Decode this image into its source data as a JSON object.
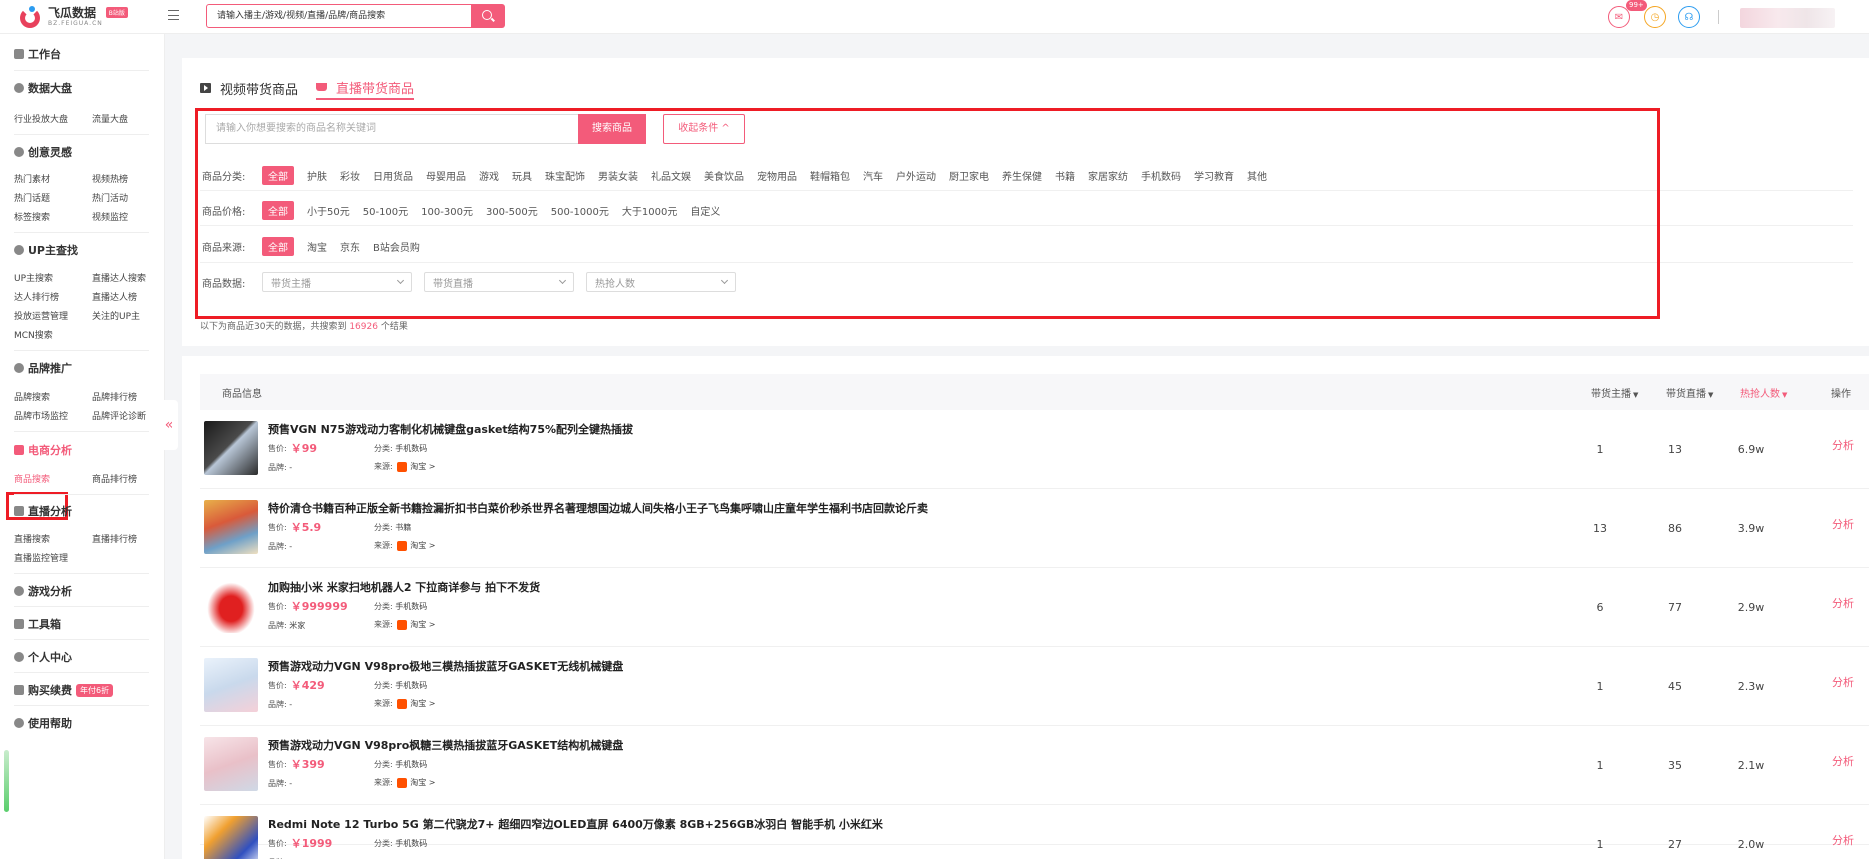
{
  "app": {
    "name": "飞瓜数据",
    "domain": "BZ.FEIGUA.CN",
    "badge": "B站版"
  },
  "colors": {
    "accent": "#f35b7a",
    "annotation": "#ee1c25",
    "taobao": "#ff5000"
  },
  "top": {
    "search_value": "请输入播主/游戏/视频/直播/品牌/商品搜索",
    "msg_count": "99+",
    "icons": [
      "mail-icon",
      "clock-icon",
      "support-icon"
    ]
  },
  "sidebar": {
    "workbench": "工作台",
    "data": {
      "title": "数据大盘",
      "items": [
        "行业投放大盘",
        "流量大盘"
      ]
    },
    "creative": {
      "title": "创意灵感",
      "items": [
        "热门素材",
        "视频热榜",
        "热门话题",
        "热门活动",
        "标签搜索",
        "视频监控"
      ]
    },
    "up": {
      "title": "UP主查找",
      "items": [
        "UP主搜索",
        "直播达人搜索",
        "达人排行榜",
        "直播达人榜",
        "投放运营管理",
        "关注的UP主",
        "MCN搜索"
      ]
    },
    "brand": {
      "title": "品牌推广",
      "items": [
        "品牌搜索",
        "品牌排行榜",
        "品牌市场监控",
        "品牌评论诊断"
      ]
    },
    "ecom": {
      "title": "电商分析",
      "items": [
        "商品搜索",
        "商品排行榜"
      ]
    },
    "live": {
      "title": "直播分析",
      "items": [
        "直播搜索",
        "直播排行榜",
        "直播监控管理"
      ]
    },
    "game": "游戏分析",
    "tools": "工具箱",
    "personal": "个人中心",
    "renew": "购买续费",
    "renew_promo": "年付6折",
    "help": "使用帮助"
  },
  "tabs": [
    "视频带货商品",
    "直播带货商品"
  ],
  "filter": {
    "keyword_placeholder": "请输入你想要搜索的商品名称关键词",
    "search_btn": "搜索商品",
    "collapse_btn": "收起条件 ^",
    "category_label": "商品分类:",
    "categories": [
      "全部",
      "护肤",
      "彩妆",
      "日用货品",
      "母婴用品",
      "游戏",
      "玩具",
      "珠宝配饰",
      "男装女装",
      "礼品文娱",
      "美食饮品",
      "宠物用品",
      "鞋帽箱包",
      "汽车",
      "户外运动",
      "厨卫家电",
      "养生保健",
      "书籍",
      "家居家纺",
      "手机数码",
      "学习教育",
      "其他"
    ],
    "price_label": "商品价格:",
    "prices": [
      "全部",
      "小于50元",
      "50-100元",
      "100-300元",
      "300-500元",
      "500-1000元",
      "大于1000元",
      "自定义"
    ],
    "source_label": "商品来源:",
    "sources": [
      "全部",
      "淘宝",
      "京东",
      "B站会员购"
    ],
    "data_label": "商品数据:",
    "selects": [
      "带货主播",
      "带货直播",
      "热抢人数"
    ],
    "note_prefix": "以下为商品近30天的数据，共搜索到",
    "note_count": "16926",
    "note_suffix": "个结果"
  },
  "table": {
    "headers": {
      "info": "商品信息",
      "anchors": "带货主播",
      "lives": "带货直播",
      "hot": "热抢人数",
      "ops": "操作"
    },
    "sort_tri": "▼",
    "labels": {
      "price": "售价:",
      "brand": "品牌:",
      "category": "分类:",
      "source": "来源:",
      "analyze": "分析"
    },
    "rows": [
      {
        "name": "预售VGN N75游戏动力客制化机械键盘gasket结构75%配列全键热插拔",
        "price": "￥99",
        "brand": "-",
        "category": "手机数码",
        "source": "淘宝 >",
        "anchors": "1",
        "lives": "13",
        "hot": "6.9w",
        "thumb": "keyboard"
      },
      {
        "name": "特价清仓书籍百种正版全新书籍捡漏折扣书白菜价秒杀世界名著理想国边城人间失格小王子飞鸟集呼啸山庄童年学生福利书店回款论斤卖",
        "price": "￥5.9",
        "brand": "-",
        "category": "书籍",
        "source": "淘宝 >",
        "anchors": "13",
        "lives": "86",
        "hot": "3.9w",
        "thumb": "books"
      },
      {
        "name": "加购抽小米 米家扫地机器人2 下拉商详参与 拍下不发货",
        "price": "￥999999",
        "brand": "米家",
        "category": "手机数码",
        "source": "淘宝 >",
        "anchors": "6",
        "lives": "77",
        "hot": "2.9w",
        "thumb": "red"
      },
      {
        "name": "预售游戏动力VGN V98pro极地三模热插拔蓝牙GASKET无线机械键盘",
        "price": "￥429",
        "brand": "-",
        "category": "手机数码",
        "source": "淘宝 >",
        "anchors": "1",
        "lives": "45",
        "hot": "2.3w",
        "thumb": "kbd2"
      },
      {
        "name": "预售游戏动力VGN V98pro枫糖三模热插拔蓝牙GASKET结构机械键盘",
        "price": "￥399",
        "brand": "-",
        "category": "手机数码",
        "source": "淘宝 >",
        "anchors": "1",
        "lives": "35",
        "hot": "2.1w",
        "thumb": "kbd3"
      },
      {
        "name": "Redmi Note 12 Turbo 5G 第二代骁龙7+ 超细四窄边OLED直屏 6400万像素 8GB+256GB冰羽白 智能手机 小米红米",
        "price": "￥1999",
        "brand": "",
        "category": "手机数码",
        "source": "",
        "anchors": "1",
        "lives": "27",
        "hot": "2.0w",
        "thumb": "phone"
      }
    ]
  }
}
